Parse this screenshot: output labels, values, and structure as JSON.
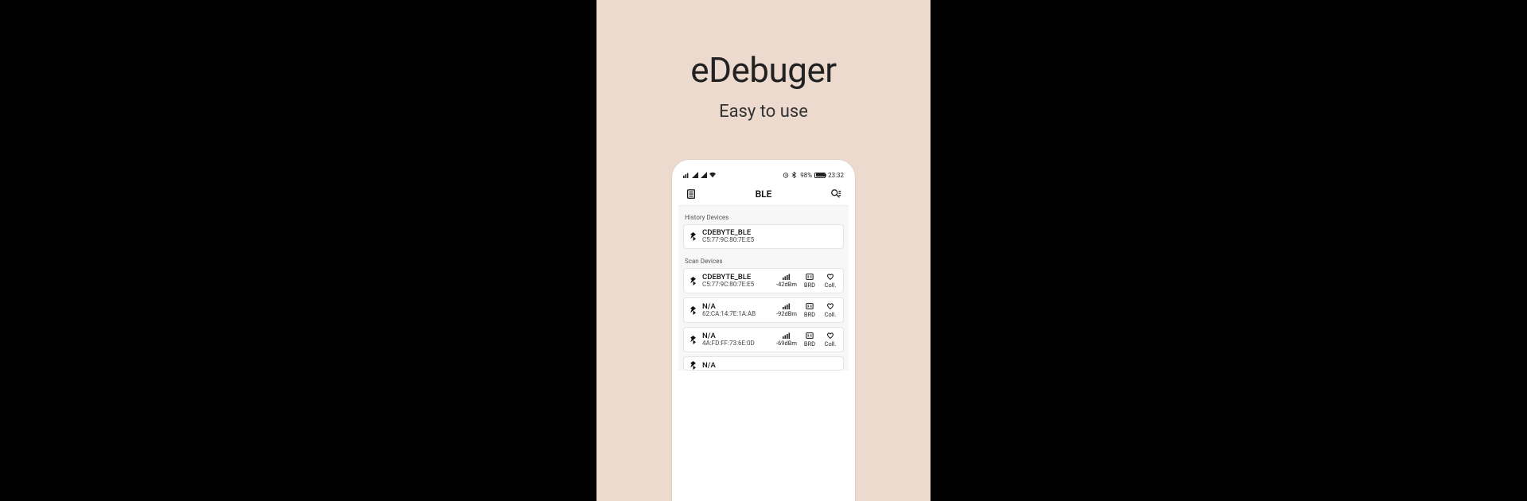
{
  "promo": {
    "title": "eDebuger",
    "subtitle": "Easy to use"
  },
  "status_bar": {
    "battery_pct": "98%",
    "time": "23:32"
  },
  "app_bar": {
    "title": "BLE"
  },
  "sections": {
    "history_label": "History Devices",
    "scan_label": "Scan Devices"
  },
  "history_devices": [
    {
      "name": "CDEBYTE_BLE",
      "mac": "C5:77:9C:80:7E:E5"
    }
  ],
  "scan_devices": [
    {
      "name": "CDEBYTE_BLE",
      "mac": "C5:77:9C:80:7E:E5",
      "rssi": "-42dBm",
      "brd": "BRD",
      "coll": "Coll."
    },
    {
      "name": "N/A",
      "mac": "62:CA:14:7E:1A:AB",
      "rssi": "-92dBm",
      "brd": "BRD",
      "coll": "Coll."
    },
    {
      "name": "N/A",
      "mac": "4A:FD:FF:73:6E:0D",
      "rssi": "-69dBm",
      "brd": "BRD",
      "coll": "Coll."
    },
    {
      "name": "N/A",
      "mac": "",
      "rssi": "",
      "brd": "",
      "coll": ""
    }
  ]
}
